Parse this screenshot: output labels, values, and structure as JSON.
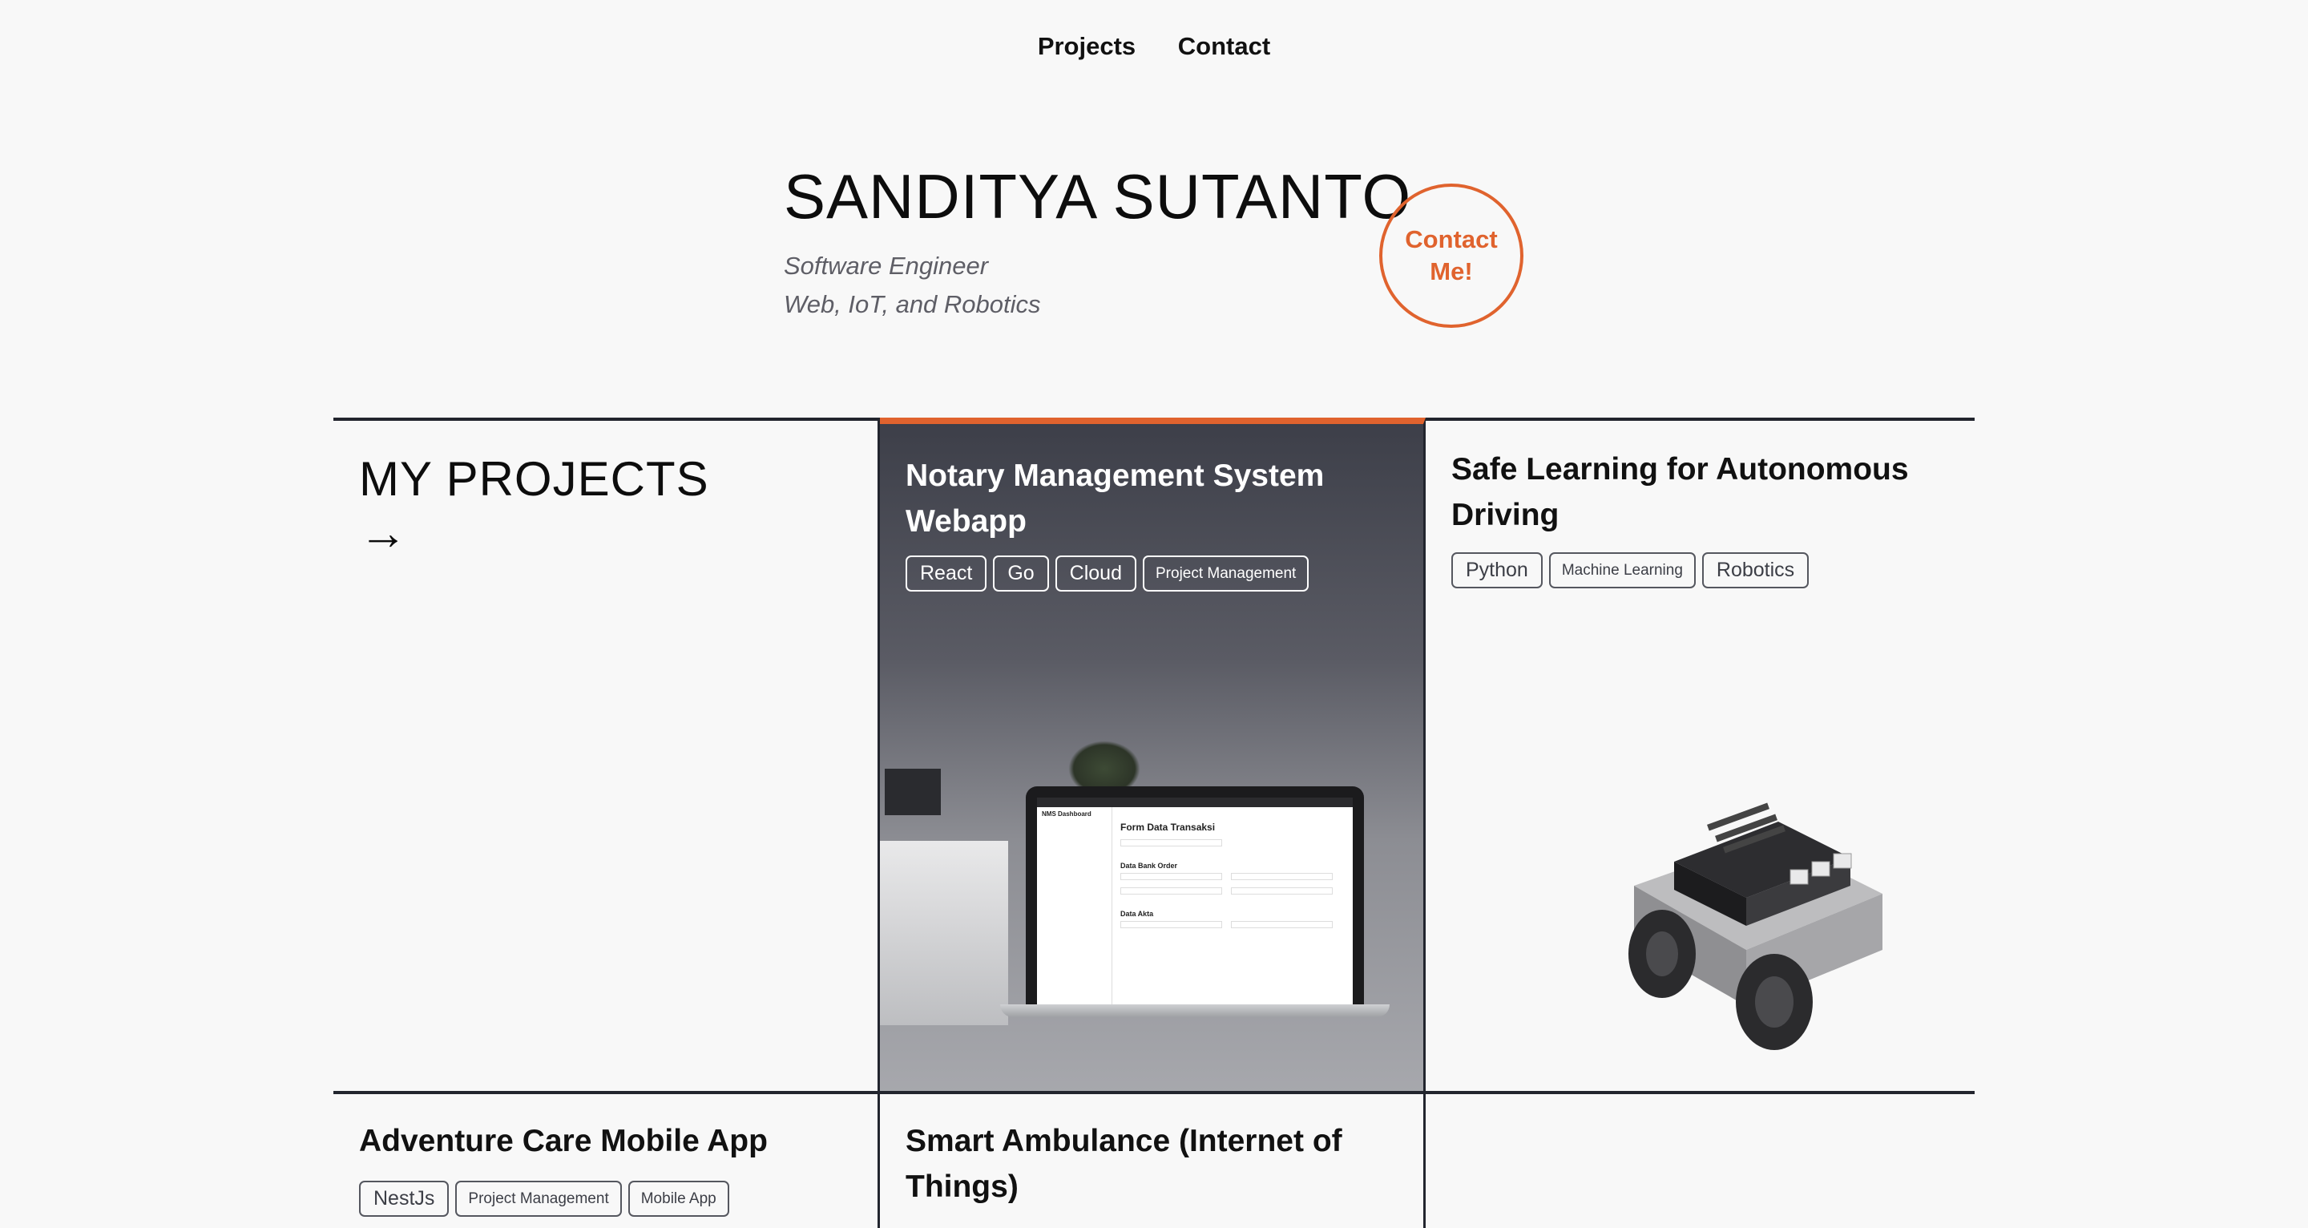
{
  "nav": {
    "items": [
      "Projects",
      "Contact"
    ]
  },
  "hero": {
    "name": "SANDITYA SUTANTO",
    "role_line1": "Software Engineer",
    "role_line2": "Web, IoT, and Robotics",
    "contact_button": "Contact Me!"
  },
  "section": {
    "heading": "MY PROJECTS",
    "arrow": "→"
  },
  "projects": [
    {
      "title": "Notary Management System Webapp",
      "tags": [
        "React",
        "Go",
        "Cloud",
        "Project Management"
      ],
      "screen": {
        "app_title": "NMS Dashboard",
        "form_title": "Form Data Transaksi",
        "section1": "Data Bank Order",
        "section2": "Data Akta"
      }
    },
    {
      "title": "Safe Learning for Autonomous Driving",
      "tags": [
        "Python",
        "Machine Learning",
        "Robotics"
      ]
    },
    {
      "title": "Adventure Care Mobile App",
      "tags": [
        "NestJs",
        "Project Management",
        "Mobile App"
      ]
    },
    {
      "title": "Smart Ambulance (Internet of Things)",
      "tags": []
    }
  ],
  "colors": {
    "accent": "#e0632e",
    "border": "#22252e",
    "background": "#f8f8f8"
  }
}
